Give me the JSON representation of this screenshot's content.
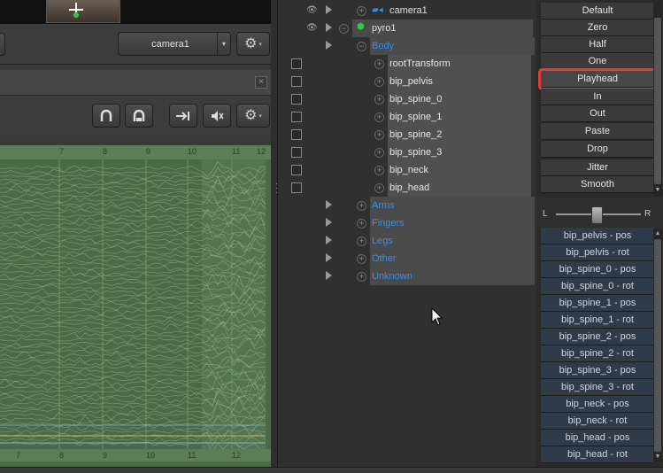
{
  "viewport": {
    "camera_dropdown": "camera1",
    "dropdown_arrow": "▾",
    "gear_icon": "gear-icon"
  },
  "timeline": {
    "ruler_numbers": [
      "7",
      "8",
      "9",
      "10",
      "11",
      "12"
    ],
    "colors": {
      "bg": "#4b6a46",
      "curve": "#a9c7a0"
    }
  },
  "tree": {
    "camera1": "camera1",
    "pyro1": "pyro1",
    "body": "Body",
    "bones": [
      "rootTransform",
      "bip_pelvis",
      "bip_spine_0",
      "bip_spine_1",
      "bip_spine_2",
      "bip_spine_3",
      "bip_neck",
      "bip_head"
    ],
    "groups": [
      "Arms",
      "Fingers",
      "Legs",
      "Other",
      "Unknown"
    ]
  },
  "tools": {
    "buttons": [
      "Default",
      "Zero",
      "Half",
      "One",
      "Playhead",
      "In",
      "Out",
      "Paste",
      "Drop",
      "Jitter",
      "Smooth"
    ],
    "highlighted": "Playhead",
    "slider_left": "L",
    "slider_right": "R",
    "slider_value": 0.5
  },
  "channels": [
    "bip_pelvis - pos",
    "bip_pelvis - rot",
    "bip_spine_0 - pos",
    "bip_spine_0 - rot",
    "bip_spine_1 - pos",
    "bip_spine_1 - rot",
    "bip_spine_2 - pos",
    "bip_spine_2 - rot",
    "bip_spine_3 - pos",
    "bip_spine_3 - rot",
    "bip_neck - pos",
    "bip_neck - rot",
    "bip_head - pos",
    "bip_head - rot"
  ],
  "colors": {
    "highlight": "#e23b3b",
    "group_text": "#3d8ee0",
    "channel_bg": "#2f3b48"
  }
}
